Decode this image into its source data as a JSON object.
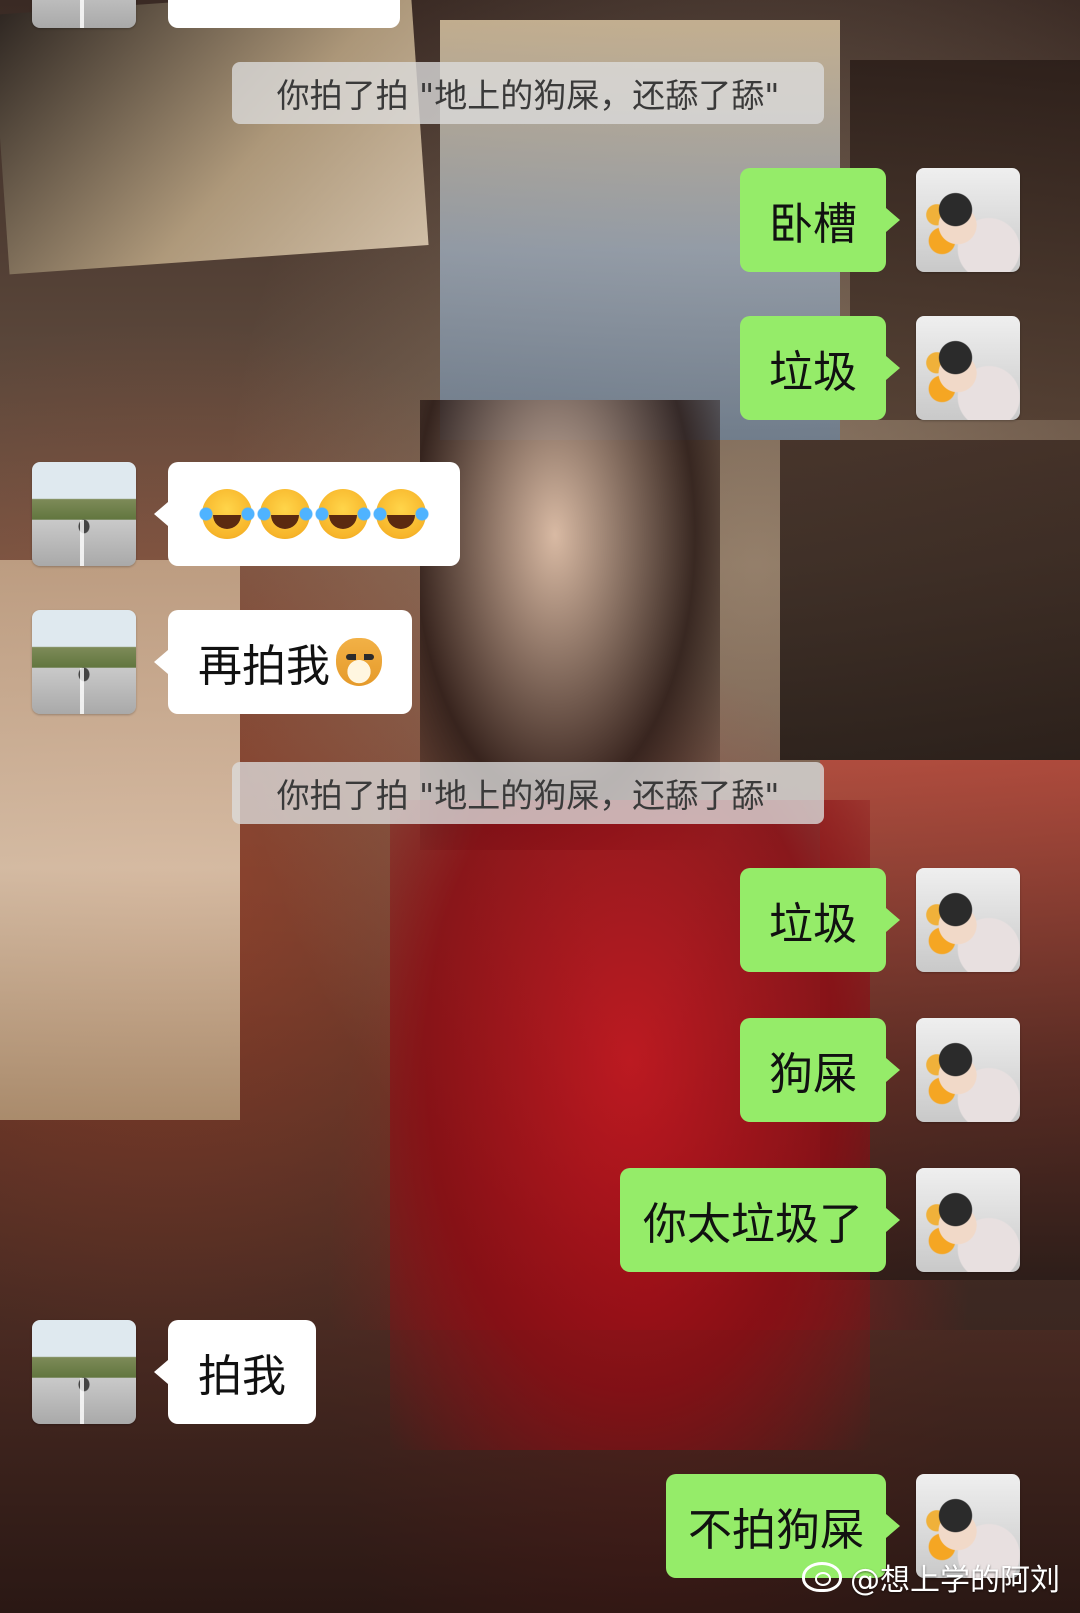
{
  "system_notice": "你拍了拍 \"地上的狗屎，还舔了舔\"",
  "messages": [
    {
      "side": "me",
      "text": "卧槽"
    },
    {
      "side": "me",
      "text": "垃圾"
    },
    {
      "side": "other",
      "text": "😂😂😂😂"
    },
    {
      "side": "other",
      "text": "再拍我"
    },
    {
      "side": "me",
      "text": "垃圾"
    },
    {
      "side": "me",
      "text": "狗屎"
    },
    {
      "side": "me",
      "text": "你太垃圾了"
    },
    {
      "side": "other",
      "text": "拍我"
    },
    {
      "side": "me",
      "text": "不拍狗屎"
    }
  ],
  "watermark": "@想上学的阿刘",
  "colors": {
    "bubble_me": "#95ec69",
    "bubble_other": "#ffffff",
    "system_bg": "#dcdcdc"
  },
  "icons": {
    "laugh": "face-with-tears-of-joy-icon",
    "doge": "doge-emoji-icon",
    "weibo": "weibo-logo-icon"
  }
}
